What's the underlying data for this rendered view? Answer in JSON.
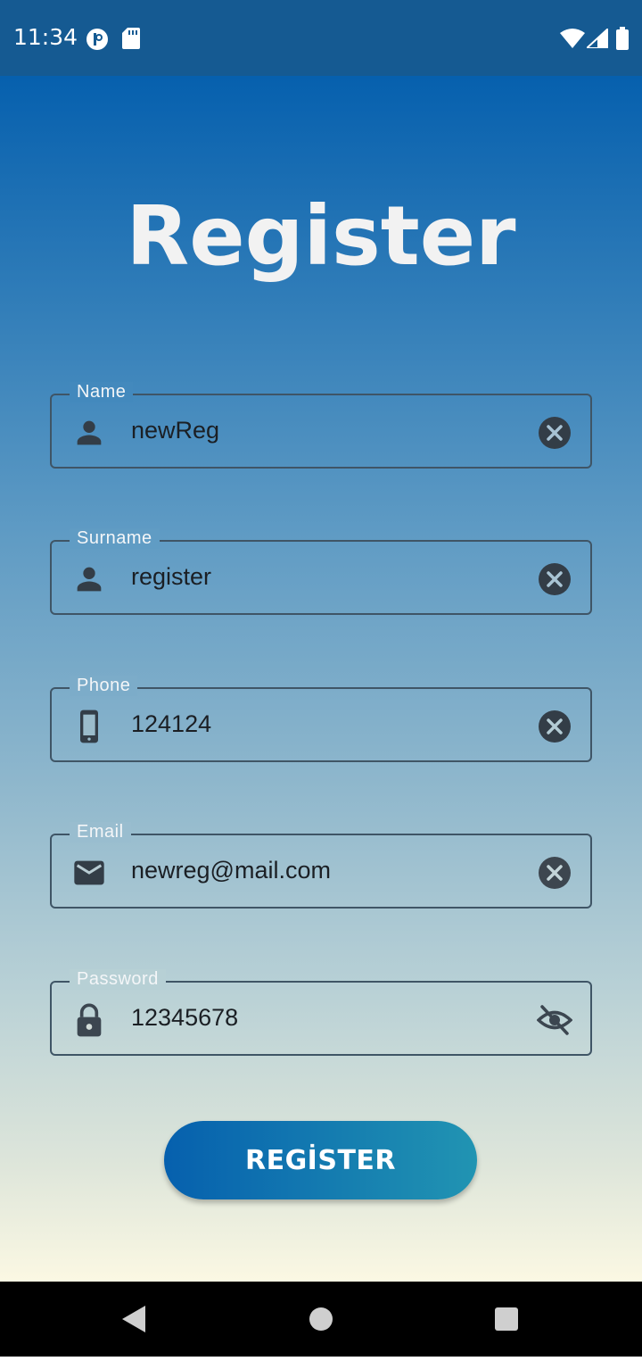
{
  "status_bar": {
    "time": "11:34",
    "icons": [
      "notification-icon",
      "sd-card-icon",
      "wifi-icon",
      "signal-icon",
      "battery-icon"
    ]
  },
  "page": {
    "title": "Register"
  },
  "form": {
    "name": {
      "label": "Name",
      "value": "newReg",
      "leading_icon": "person-icon",
      "trailing_icon": "clear-icon"
    },
    "surname": {
      "label": "Surname",
      "value": "register",
      "leading_icon": "person-icon",
      "trailing_icon": "clear-icon"
    },
    "phone": {
      "label": "Phone",
      "value": "124124",
      "leading_icon": "phone-icon",
      "trailing_icon": "clear-icon"
    },
    "email": {
      "label": "Email",
      "value": "newreg@mail.com",
      "leading_icon": "mail-icon",
      "trailing_icon": "clear-icon"
    },
    "password": {
      "label": "Password",
      "value": "12345678",
      "leading_icon": "lock-icon",
      "trailing_icon": "visibility-off-icon"
    }
  },
  "actions": {
    "register_label": "REGİSTER"
  },
  "nav_bar": {
    "buttons": [
      "back-icon",
      "home-icon",
      "recents-icon"
    ]
  },
  "colors": {
    "status_bar": "#155a92",
    "gradient_top": "#0660ae",
    "gradient_bottom": "#fbf8e3",
    "button_start": "#0660ae",
    "button_end": "#2194b2",
    "field_border": "#3f5566",
    "icon": "#3c4650"
  }
}
